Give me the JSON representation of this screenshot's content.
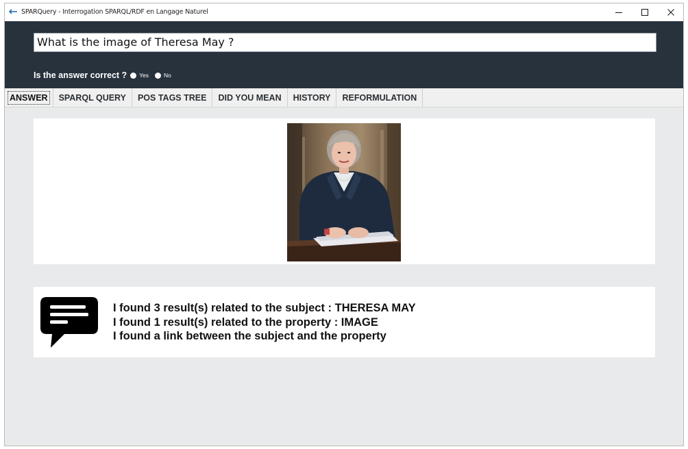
{
  "window": {
    "title": "SPARQuery - Interrogation SPARQL/RDF en Langage Naturel",
    "controls": {
      "minimize_icon": "minimize-icon",
      "maximize_icon": "maximize-icon",
      "close_icon": "close-icon"
    }
  },
  "query": {
    "value": "What is the image of Theresa May ?"
  },
  "feedback": {
    "question": "Is the answer correct ?",
    "options": [
      {
        "label": "Yes"
      },
      {
        "label": "No"
      }
    ]
  },
  "tabs": [
    {
      "label": "ANSWER",
      "active": true
    },
    {
      "label": "SPARQL QUERY",
      "active": false
    },
    {
      "label": "POS TAGS TREE",
      "active": false
    },
    {
      "label": "DID YOU MEAN",
      "active": false
    },
    {
      "label": "HISTORY",
      "active": false
    },
    {
      "label": "REFORMULATION",
      "active": false
    }
  ],
  "answer": {
    "image_icon": "portrait-photo",
    "message_icon": "chat-bubble-icon",
    "messages": [
      "I found 3 result(s) related to the subject : THERESA MAY",
      "I found 1 result(s) related to the property : IMAGE",
      "I found a link between the subject and the property"
    ]
  },
  "colors": {
    "header_bg": "#27323d",
    "content_bg": "#e9eaeb",
    "tab_bar_bg": "#f0f0f0"
  }
}
